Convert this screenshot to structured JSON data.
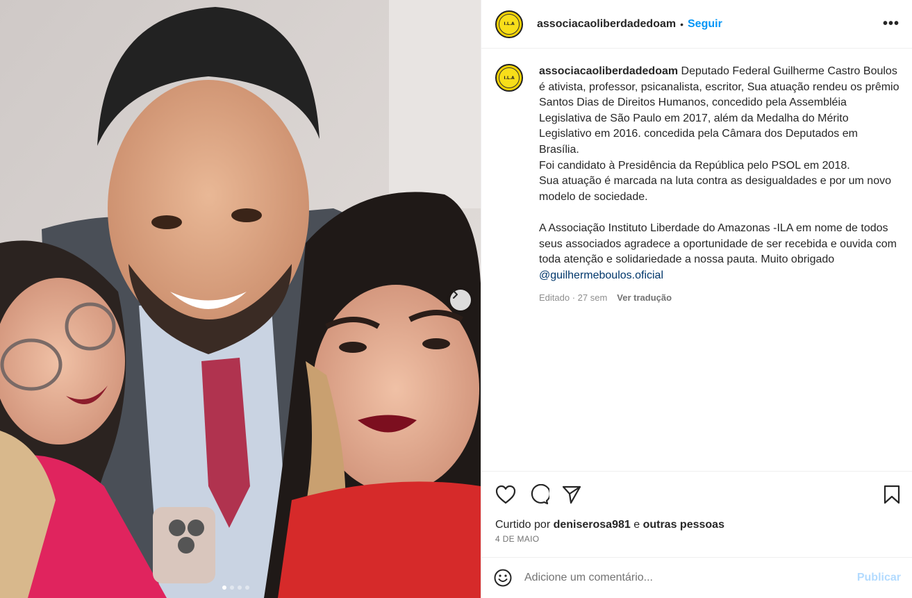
{
  "post": {
    "username": "associacaoliberdadedoam",
    "separator": "•",
    "follow_label": "Seguir",
    "more_label": "•••",
    "avatar_text": "I.L.A"
  },
  "caption": {
    "username": "associacaoliberdadedoam",
    "paragraph1": "Deputado Federal Guilherme Castro Boulos é ativista, professor, psicanalista, escritor, Sua atuação rendeu os prêmio Santos Dias de Direitos Humanos, concedido pela Assembléia Legislativa de São Paulo em 2017, além da Medalha do Mérito Legislativo em 2016. concedida pela Câmara dos Deputados em Brasília.\nFoi candidato à Presidência da República pelo PSOL em 2018.\nSua atuação é marcada na luta contra as desigualdades e por um novo modelo de sociedade.",
    "paragraph2": "A Associação Instituto Liberdade do Amazonas -ILA em nome de todos seus associados agradece a oportunidade de ser recebida e ouvida com toda atenção e solidariedade a nossa pauta. Muito obrigado ",
    "mention": "@guilhermeboulos.oficial",
    "edited_label": "Editado · 27 sem",
    "translate_label": "Ver tradução"
  },
  "engagement": {
    "liked_prefix": "Curtido por ",
    "liked_user": "deniserosa981",
    "liked_mid": " e ",
    "liked_others": "outras pessoas",
    "date": "4 DE MAIO"
  },
  "comment": {
    "placeholder": "Adicione um comentário...",
    "publish_label": "Publicar"
  },
  "carousel": {
    "total": 4,
    "active_index": 0
  },
  "colors": {
    "accent_blue": "#0095f6",
    "publish_disabled": "#b3dbff",
    "avatar_yellow": "#f6d200"
  }
}
